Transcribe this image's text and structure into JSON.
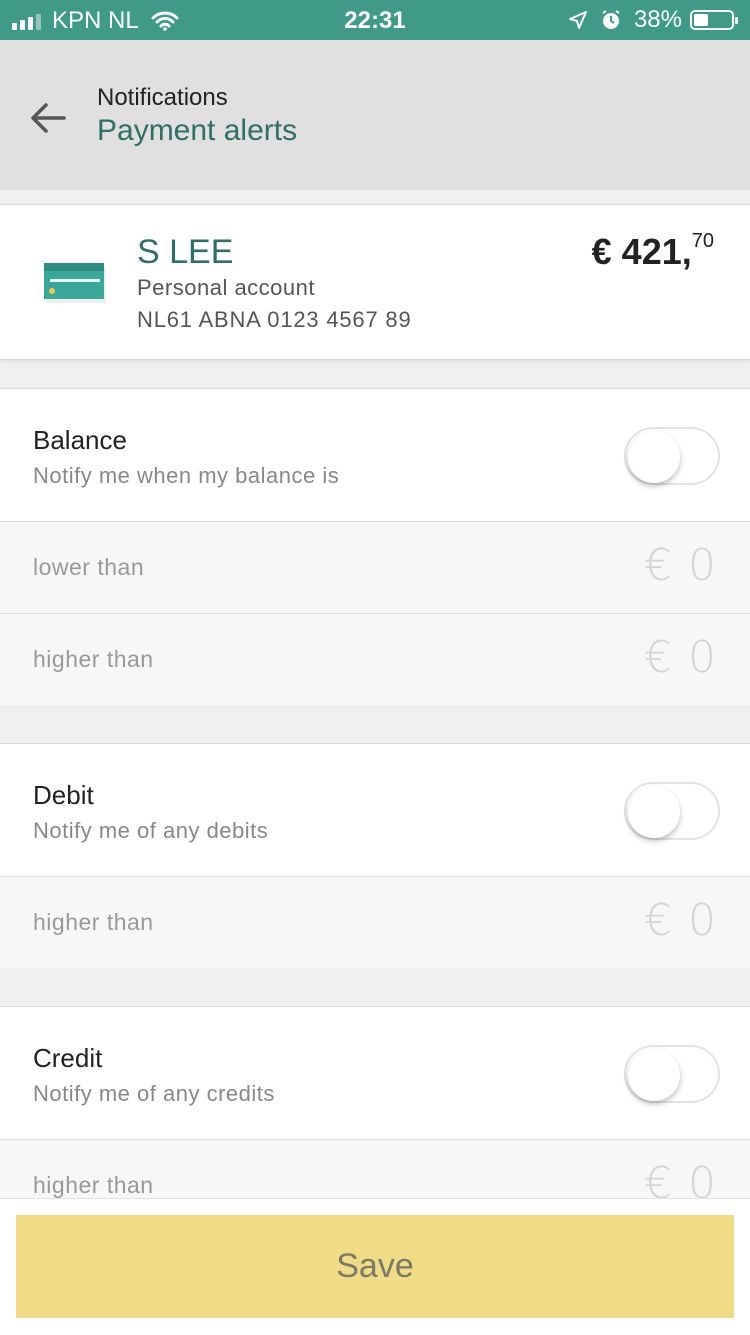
{
  "status_bar": {
    "carrier": "KPN NL",
    "time": "22:31",
    "battery": "38%",
    "battery_level": 0.38
  },
  "header": {
    "subtitle": "Notifications",
    "title": "Payment alerts"
  },
  "account": {
    "name": "S LEE",
    "type": "Personal account",
    "iban": "NL61 ABNA 0123 4567 89",
    "amount_main": "€ 421,",
    "amount_cents": "70"
  },
  "sections": {
    "balance": {
      "title": "Balance",
      "description": "Notify me when my balance is",
      "enabled": false,
      "rows": [
        {
          "label": "lower than",
          "currency": "€",
          "value": "0"
        },
        {
          "label": "higher than",
          "currency": "€",
          "value": "0"
        }
      ]
    },
    "debit": {
      "title": "Debit",
      "description": "Notify me of any debits",
      "enabled": false,
      "rows": [
        {
          "label": "higher than",
          "currency": "€",
          "value": "0"
        }
      ]
    },
    "credit": {
      "title": "Credit",
      "description": "Notify me of any credits",
      "enabled": false,
      "rows": [
        {
          "label": "higher than",
          "currency": "€",
          "value": "0"
        }
      ]
    }
  },
  "actions": {
    "save_label": "Save"
  },
  "colors": {
    "status_bar": "#3f9a87",
    "accent_text": "#2f6f66",
    "save_button": "#f0dc84"
  }
}
